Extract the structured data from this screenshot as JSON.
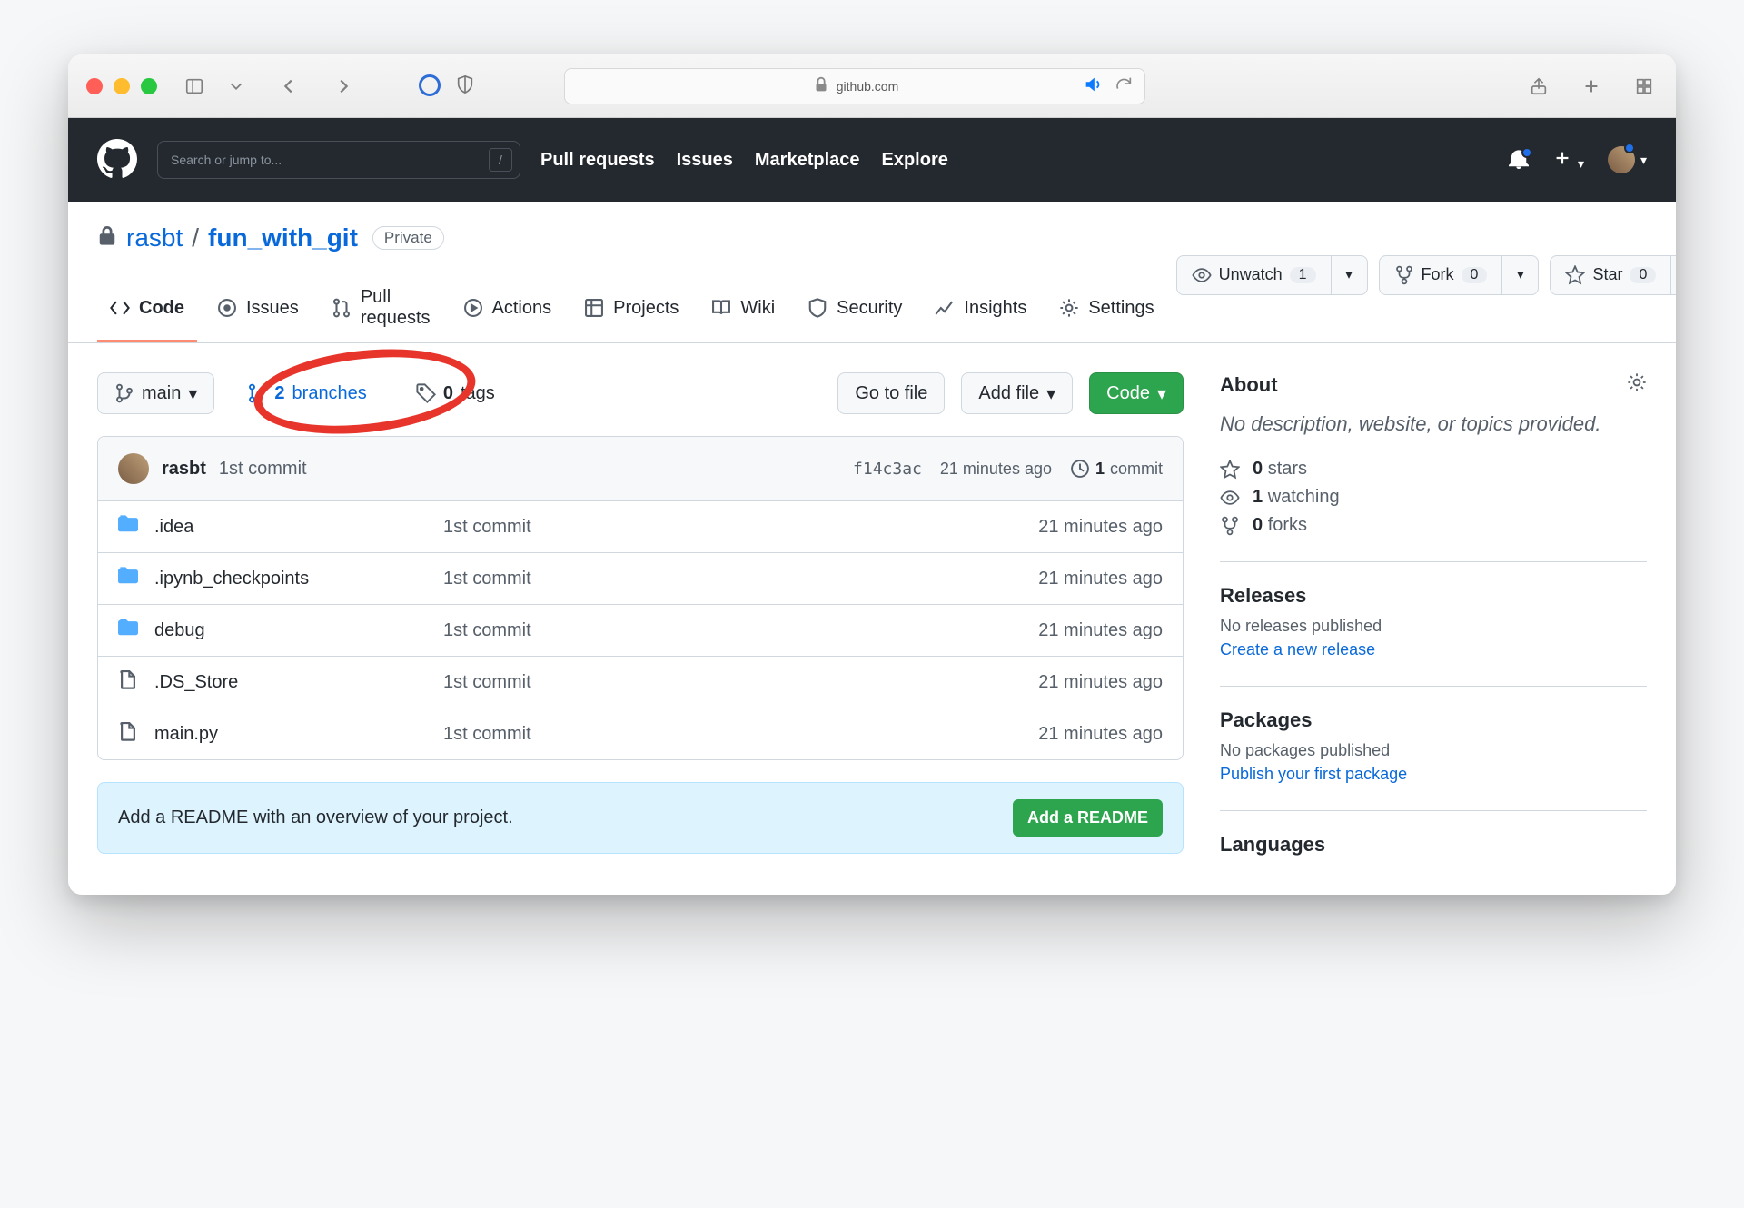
{
  "browser": {
    "url_host": "github.com"
  },
  "gh_header": {
    "search_placeholder": "Search or jump to...",
    "nav": [
      "Pull requests",
      "Issues",
      "Marketplace",
      "Explore"
    ]
  },
  "repo": {
    "owner": "rasbt",
    "name": "fun_with_git",
    "visibility": "Private",
    "actions": {
      "watch_label": "Unwatch",
      "watch_count": "1",
      "fork_label": "Fork",
      "fork_count": "0",
      "star_label": "Star",
      "star_count": "0"
    },
    "tabs": [
      "Code",
      "Issues",
      "Pull requests",
      "Actions",
      "Projects",
      "Wiki",
      "Security",
      "Insights",
      "Settings"
    ],
    "branch": "main",
    "branches_count": "2",
    "branches_label": "branches",
    "tags_count": "0",
    "tags_label": "tags",
    "toolbar": {
      "goto": "Go to file",
      "add": "Add file",
      "code": "Code"
    },
    "latest_commit": {
      "author": "rasbt",
      "message": "1st commit",
      "sha": "f14c3ac",
      "time": "21 minutes ago",
      "count": "1",
      "count_label": "commit"
    },
    "files": [
      {
        "type": "dir",
        "name": ".idea",
        "msg": "1st commit",
        "time": "21 minutes ago"
      },
      {
        "type": "dir",
        "name": ".ipynb_checkpoints",
        "msg": "1st commit",
        "time": "21 minutes ago"
      },
      {
        "type": "dir",
        "name": "debug",
        "msg": "1st commit",
        "time": "21 minutes ago"
      },
      {
        "type": "file",
        "name": ".DS_Store",
        "msg": "1st commit",
        "time": "21 minutes ago"
      },
      {
        "type": "file",
        "name": "main.py",
        "msg": "1st commit",
        "time": "21 minutes ago"
      }
    ],
    "readme_prompt": "Add a README with an overview of your project.",
    "readme_btn": "Add a README"
  },
  "sidebar": {
    "about": "About",
    "desc": "No description, website, or topics provided.",
    "stars_count": "0",
    "stars_label": "stars",
    "watching_count": "1",
    "watching_label": "watching",
    "forks_count": "0",
    "forks_label": "forks",
    "releases": {
      "title": "Releases",
      "sub": "No releases published",
      "link": "Create a new release"
    },
    "packages": {
      "title": "Packages",
      "sub": "No packages published",
      "link": "Publish your first package"
    },
    "languages": {
      "title": "Languages"
    }
  }
}
